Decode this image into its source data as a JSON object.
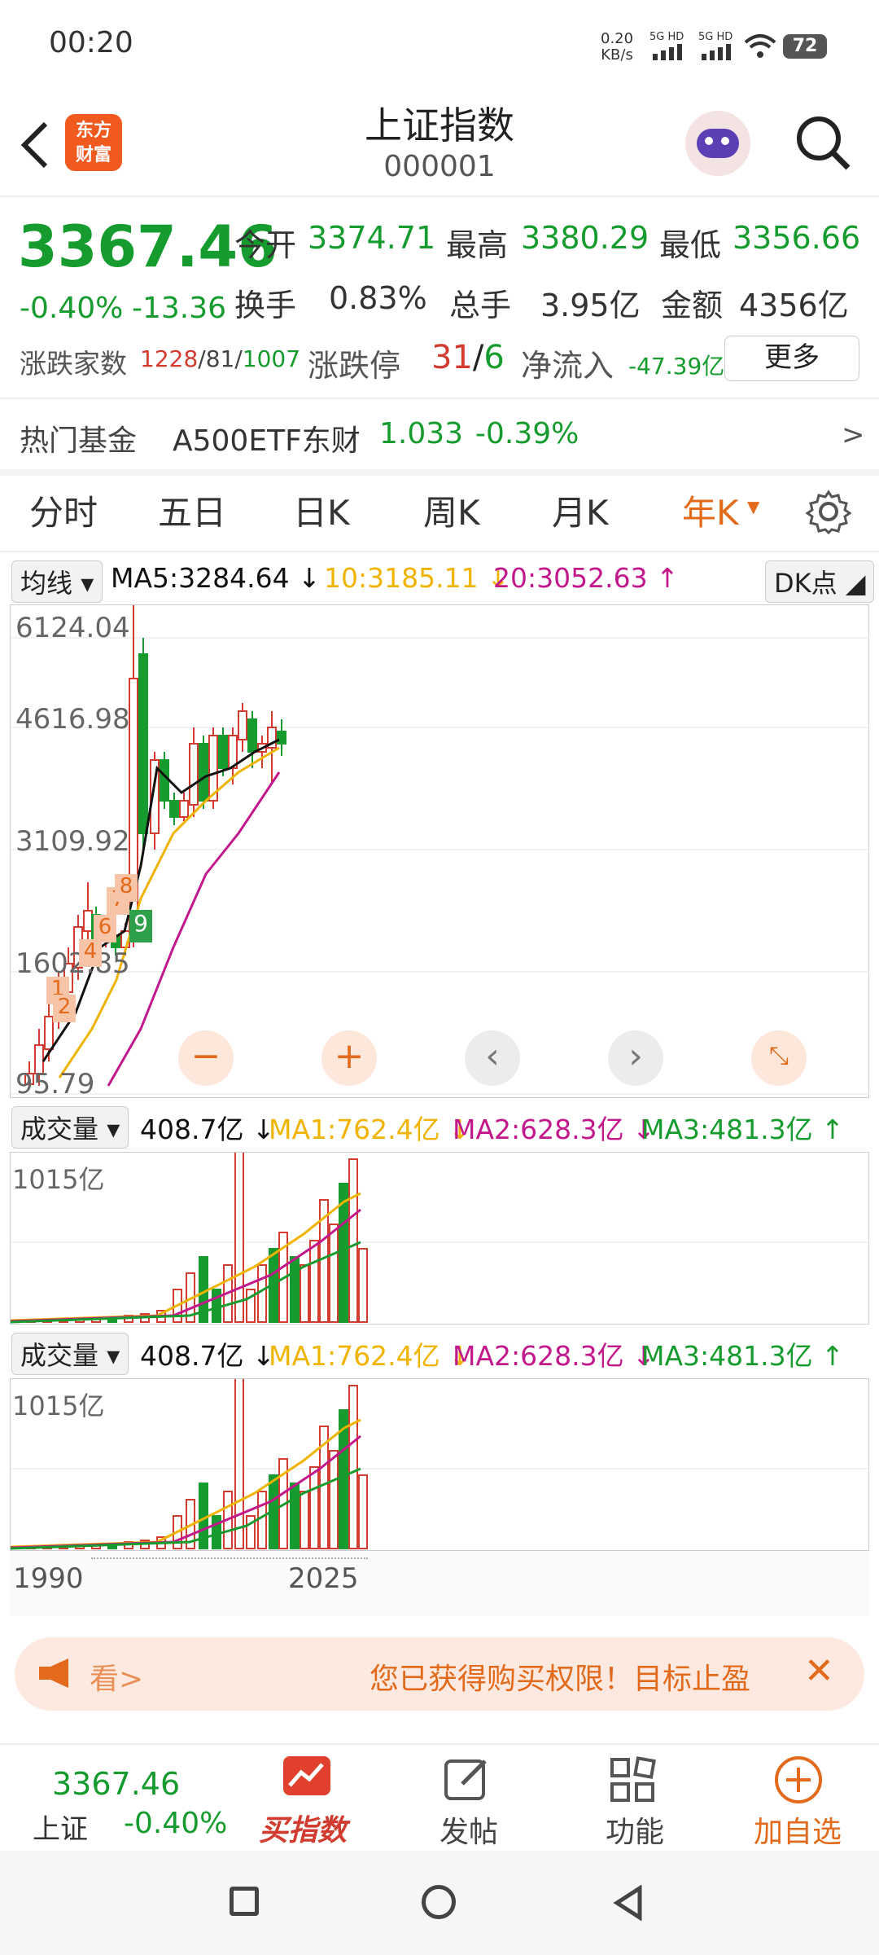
{
  "status": {
    "time": "00:20",
    "speed": "0.20",
    "speed_unit": "KB/s",
    "net1": "5G HD",
    "net2": "5G HD",
    "battery": "72"
  },
  "header": {
    "logo_line1": "东方",
    "logo_line2": "财富",
    "title": "上证指数",
    "code": "000001"
  },
  "quote": {
    "price": "3367.46",
    "change_pct": "-0.40%",
    "change": "-13.36",
    "open_label": "今开",
    "open": "3374.71",
    "high_label": "最高",
    "high": "3380.29",
    "low_label": "最低",
    "low": "3356.66",
    "turnover_label": "换手",
    "turnover": "0.83%",
    "volume_label": "总手",
    "volume": "3.95亿",
    "amount_label": "金额",
    "amount": "4356亿",
    "breadth_label": "涨跌家数",
    "breadth_up": "1228",
    "breadth_sep1": "/",
    "breadth_flat": "81",
    "breadth_sep2": "/",
    "breadth_down": "1007",
    "limit_label": "涨跌停",
    "limit_up": "31",
    "limit_sep": "/",
    "limit_down": "6",
    "netflow_label": "净流入",
    "netflow": "-47.39亿",
    "more_button": "更多"
  },
  "fund": {
    "label": "热门基金",
    "name": "A500ETF东财",
    "price": "1.033",
    "change": "-0.39%",
    "arrow": ">"
  },
  "tabs": [
    "分时",
    "五日",
    "日K",
    "周K",
    "月K",
    "年K"
  ],
  "active_tab": "年K",
  "ma_bar": {
    "selector": "均线",
    "ma5": "MA5:3284.64 ↓",
    "ma10": "10:3185.11 ↓",
    "ma20": "20:3052.63 ↑",
    "dk": "DK点"
  },
  "y_labels": [
    "6124.04",
    "4616.98",
    "3109.92",
    "1602.85",
    "95.79"
  ],
  "vol_bar": {
    "selector": "成交量",
    "value": "408.7亿 ↓",
    "ma1": "MA1:762.4亿 ↓",
    "ma2": "MA2:628.3亿 ↓",
    "ma3": "MA3:481.3亿 ↑",
    "max": "1015亿"
  },
  "x_labels": {
    "start": "1990",
    "end": "2025"
  },
  "markers": [
    "1",
    "2",
    "4",
    "6",
    "7",
    "8",
    "9"
  ],
  "banner": {
    "left": "看>",
    "text": "您已获得购买权限！目标止盈",
    "close": "✕"
  },
  "bottom": {
    "price": "3367.46",
    "name": "上证",
    "change": "-0.40%",
    "buy": "买指数",
    "post": "发帖",
    "func": "功能",
    "add": "加自选"
  },
  "colors": {
    "up": "#d23b2f",
    "down": "#169b2e",
    "accent": "#e36a1b",
    "ma5": "#111111",
    "ma10": "#f0b400",
    "ma20": "#c2188c"
  }
}
